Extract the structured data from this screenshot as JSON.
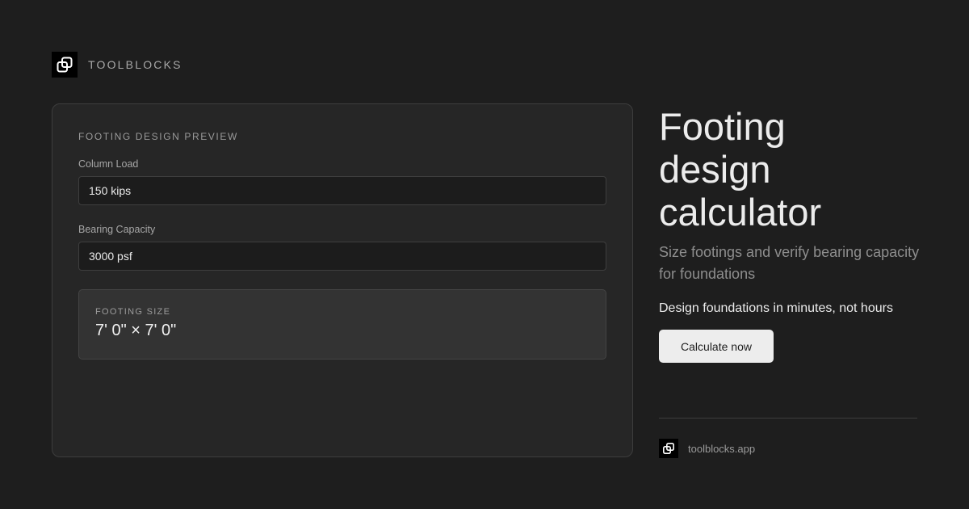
{
  "brand": {
    "name": "TOOLBLOCKS",
    "icon": "toolblocks-logo-icon"
  },
  "preview": {
    "title": "FOOTING DESIGN PREVIEW",
    "fields": [
      {
        "label": "Column Load",
        "value": "150 kips"
      },
      {
        "label": "Bearing Capacity",
        "value": "3000 psf"
      }
    ],
    "result": {
      "label": "FOOTING SIZE",
      "value": "7' 0\" × 7' 0\""
    }
  },
  "hero": {
    "headline": [
      "Footing",
      "design",
      "calculator"
    ],
    "subtitle": "Size footings and verify bearing capacity for foundations",
    "tagline": "Design foundations in minutes, not hours",
    "cta_label": "Calculate now"
  },
  "footer": {
    "url": "toolblocks.app",
    "icon": "toolblocks-logo-icon"
  },
  "colors": {
    "background": "#1e1e1e",
    "card": "#262626",
    "cta": "#ededed"
  }
}
